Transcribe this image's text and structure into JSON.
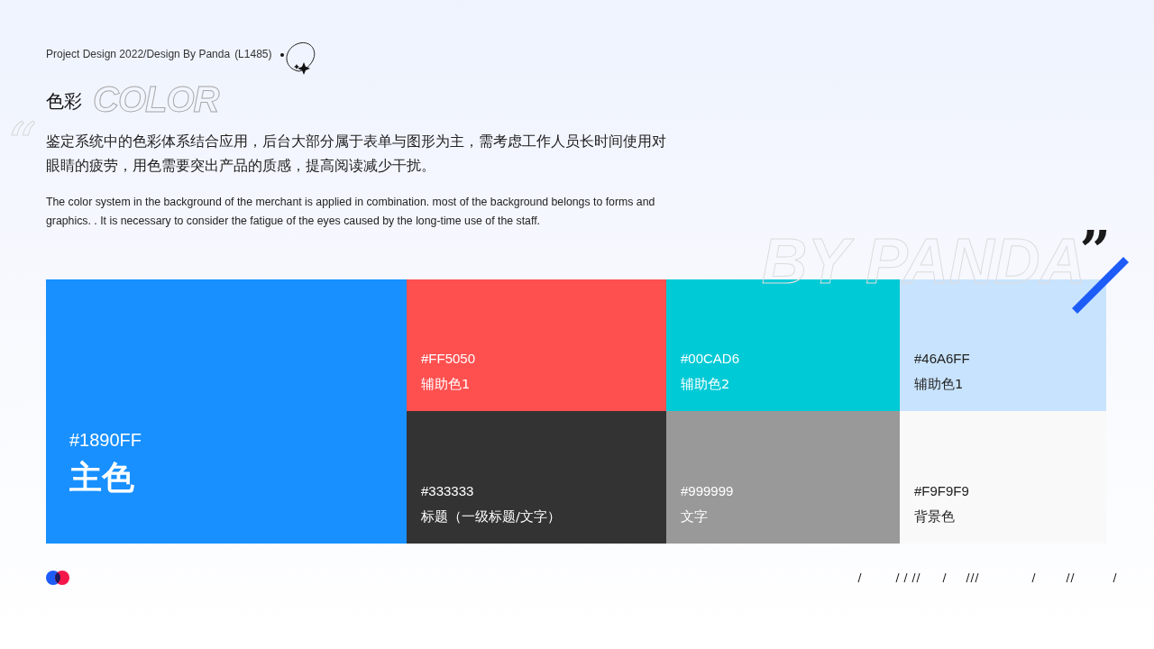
{
  "header": {
    "credit": "Project Design 2022/Design By Panda",
    "code": "(L1485)"
  },
  "title": {
    "text": "色彩",
    "ghost": "COLOR"
  },
  "open_quote": "“",
  "intro_zh": "鉴定系统中的色彩体系结合应用，后台大部分属于表单与图形为主，需考虑工作人员长时间使用对眼睛的疲劳，用色需要突出产品的质感，提高阅读减少干扰。",
  "intro_en": "The color system in the background of the merchant is applied in combination. most of the background belongs to forms and graphics. . It is necessary to consider the fatigue of the eyes caused by the long-time use of the staff.",
  "ghost_signature": "BY PANDA",
  "close_quote": "”",
  "primary": {
    "hex": "#1890FF",
    "label": "主色",
    "color": "#1890ff"
  },
  "swatches": [
    {
      "hex": "#FF5050",
      "label": "辅助色1",
      "color": "#ff5050"
    },
    {
      "hex": "#00CAD6",
      "label": "辅助色2",
      "color": "#00cad6"
    },
    {
      "hex": "#46A6FF",
      "label": "辅助色1",
      "color": "#c8e3fd"
    },
    {
      "hex": "#333333",
      "label": "标题（一级标题/文字）",
      "color": "#333333"
    },
    {
      "hex": "#999999",
      "label": "文字",
      "color": "#999999"
    },
    {
      "hex": "#F9F9F9",
      "label": "背景色",
      "color": "#f9f9f9"
    }
  ]
}
